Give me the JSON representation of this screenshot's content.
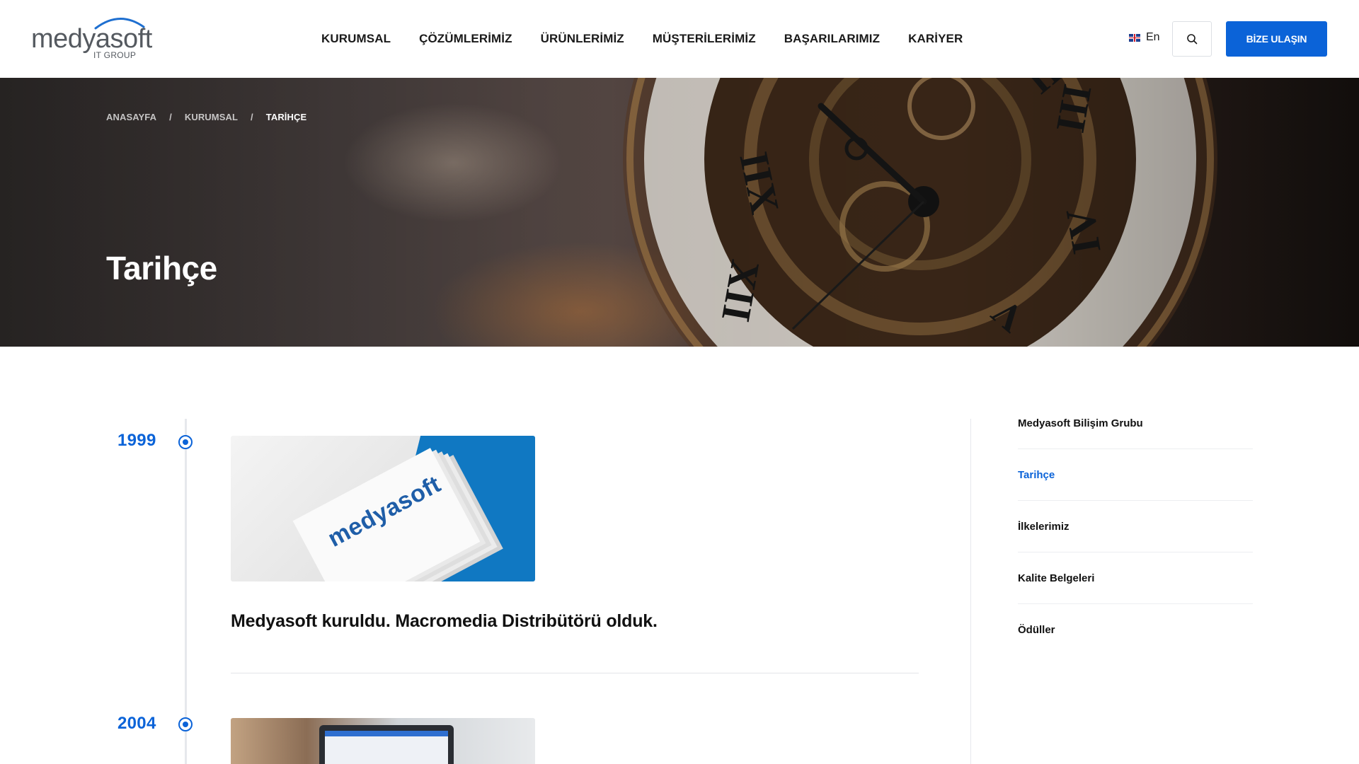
{
  "brand": {
    "name": "medyasoft",
    "sub": "IT GROUP",
    "accent": "#0b63d8"
  },
  "nav": {
    "items": [
      {
        "label": "KURUMSAL"
      },
      {
        "label": "ÇÖZÜMLERİMİZ"
      },
      {
        "label": "ÜRÜNLERİMİZ"
      },
      {
        "label": "MÜŞTERİLERİMİZ"
      },
      {
        "label": "BAŞARILARIMIZ"
      },
      {
        "label": "KARİYER"
      }
    ],
    "lang": "En",
    "lang_icon": "uk-flag-icon",
    "search_icon": "search-icon",
    "cta": "BİZE ULAŞIN"
  },
  "hero": {
    "breadcrumb": [
      "ANASAYFA",
      "/",
      "KURUMSAL",
      "/",
      "TARİHÇE"
    ],
    "title": "Tarihçe"
  },
  "timeline": [
    {
      "year": "1999",
      "title": "Medyasoft kuruldu. Macromedia Distribütörü olduk.",
      "image_text": "medyasoft"
    },
    {
      "year": "2004"
    }
  ],
  "sidebar": {
    "items": [
      {
        "label": "Medyasoft Bilişim Grubu"
      },
      {
        "label": "Tarihçe",
        "active": true
      },
      {
        "label": "İlkelerimiz"
      },
      {
        "label": "Kalite Belgeleri"
      },
      {
        "label": "Ödüller"
      }
    ]
  }
}
